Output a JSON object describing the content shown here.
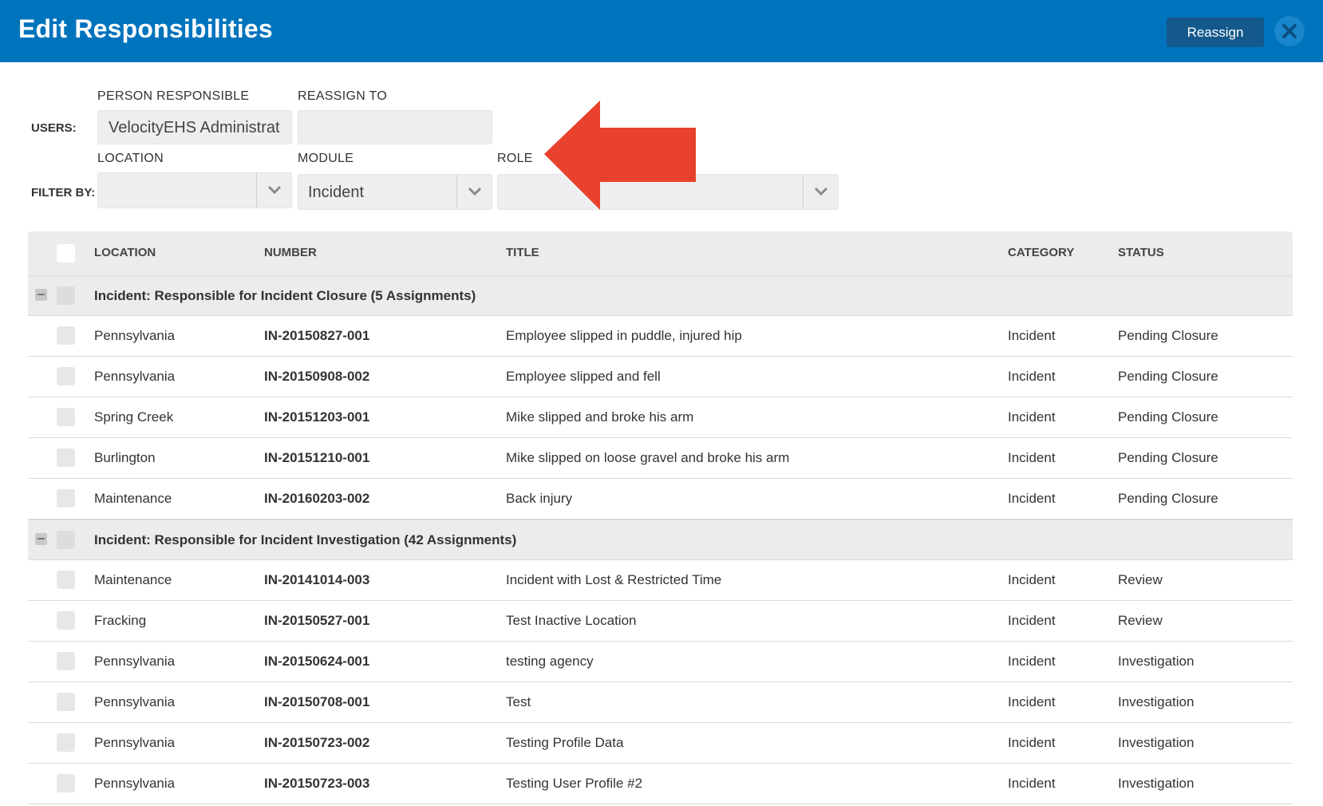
{
  "header": {
    "title": "Edit Responsibilities",
    "reassign_label": "Reassign",
    "close_icon": "close-icon"
  },
  "users": {
    "row_label": "USERS:",
    "person_label": "PERSON RESPONSIBLE",
    "person_value": "VelocityEHS Administrat",
    "reassign_label": "REASSIGN TO",
    "reassign_value": ""
  },
  "filters": {
    "row_label": "FILTER BY:",
    "location_label": "LOCATION",
    "location_value": "",
    "module_label": "MODULE",
    "module_value": "Incident",
    "role_label": "ROLE",
    "role_value": ""
  },
  "annotation": {
    "arrow_color": "#e8412e"
  },
  "table": {
    "columns": [
      "LOCATION",
      "NUMBER",
      "TITLE",
      "CATEGORY",
      "STATUS"
    ],
    "groups": [
      {
        "title": "Incident: Responsible for Incident Closure (5 Assignments)",
        "rows": [
          {
            "location": "Pennsylvania",
            "number": "IN-20150827-001",
            "title": "Employee slipped in puddle, injured hip",
            "category": "Incident",
            "status": "Pending Closure"
          },
          {
            "location": "Pennsylvania",
            "number": "IN-20150908-002",
            "title": "Employee slipped and fell",
            "category": "Incident",
            "status": "Pending Closure"
          },
          {
            "location": "Spring Creek",
            "number": "IN-20151203-001",
            "title": "Mike slipped and broke his arm",
            "category": "Incident",
            "status": "Pending Closure"
          },
          {
            "location": "Burlington",
            "number": "IN-20151210-001",
            "title": "Mike slipped on loose gravel and broke his arm",
            "category": "Incident",
            "status": "Pending Closure"
          },
          {
            "location": "Maintenance",
            "number": "IN-20160203-002",
            "title": "Back injury",
            "category": "Incident",
            "status": "Pending Closure"
          }
        ]
      },
      {
        "title": "Incident: Responsible for Incident Investigation (42 Assignments)",
        "rows": [
          {
            "location": "Maintenance",
            "number": "IN-20141014-003",
            "title": "Incident with Lost & Restricted Time",
            "category": "Incident",
            "status": "Review"
          },
          {
            "location": "Fracking",
            "number": "IN-20150527-001",
            "title": "Test Inactive Location",
            "category": "Incident",
            "status": "Review"
          },
          {
            "location": "Pennsylvania",
            "number": "IN-20150624-001",
            "title": "testing agency",
            "category": "Incident",
            "status": "Investigation"
          },
          {
            "location": "Pennsylvania",
            "number": "IN-20150708-001",
            "title": "Test",
            "category": "Incident",
            "status": "Investigation"
          },
          {
            "location": "Pennsylvania",
            "number": "IN-20150723-002",
            "title": "Testing Profile Data",
            "category": "Incident",
            "status": "Investigation"
          },
          {
            "location": "Pennsylvania",
            "number": "IN-20150723-003",
            "title": "Testing User Profile #2",
            "category": "Incident",
            "status": "Investigation"
          }
        ]
      }
    ]
  }
}
